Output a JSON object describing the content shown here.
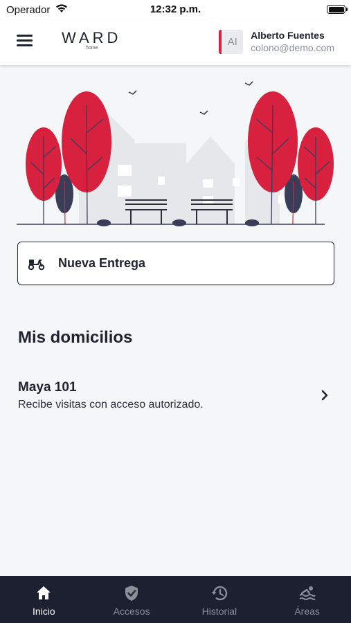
{
  "status_bar": {
    "carrier": "Operador",
    "time": "12:32 p.m."
  },
  "header": {
    "logo_text": "WARD",
    "logo_sub": "home",
    "user": {
      "initials": "AI",
      "name": "Alberto Fuentes",
      "email": "colono@demo.com"
    }
  },
  "actions": {
    "new_delivery_label": "Nueva Entrega"
  },
  "section": {
    "title": "Mis domicilios"
  },
  "addresses": [
    {
      "name": "Maya 101",
      "description": "Recibe visitas con acceso autorizado."
    }
  ],
  "tabs": [
    {
      "label": "Inicio",
      "icon": "home-icon",
      "active": true
    },
    {
      "label": "Accesos",
      "icon": "shield-check-icon",
      "active": false
    },
    {
      "label": "Historial",
      "icon": "history-icon",
      "active": false
    },
    {
      "label": "Áreas",
      "icon": "pool-icon",
      "active": false
    }
  ],
  "colors": {
    "accent": "#d7213f",
    "dark": "#1d2030",
    "background": "#f5f6f8"
  }
}
